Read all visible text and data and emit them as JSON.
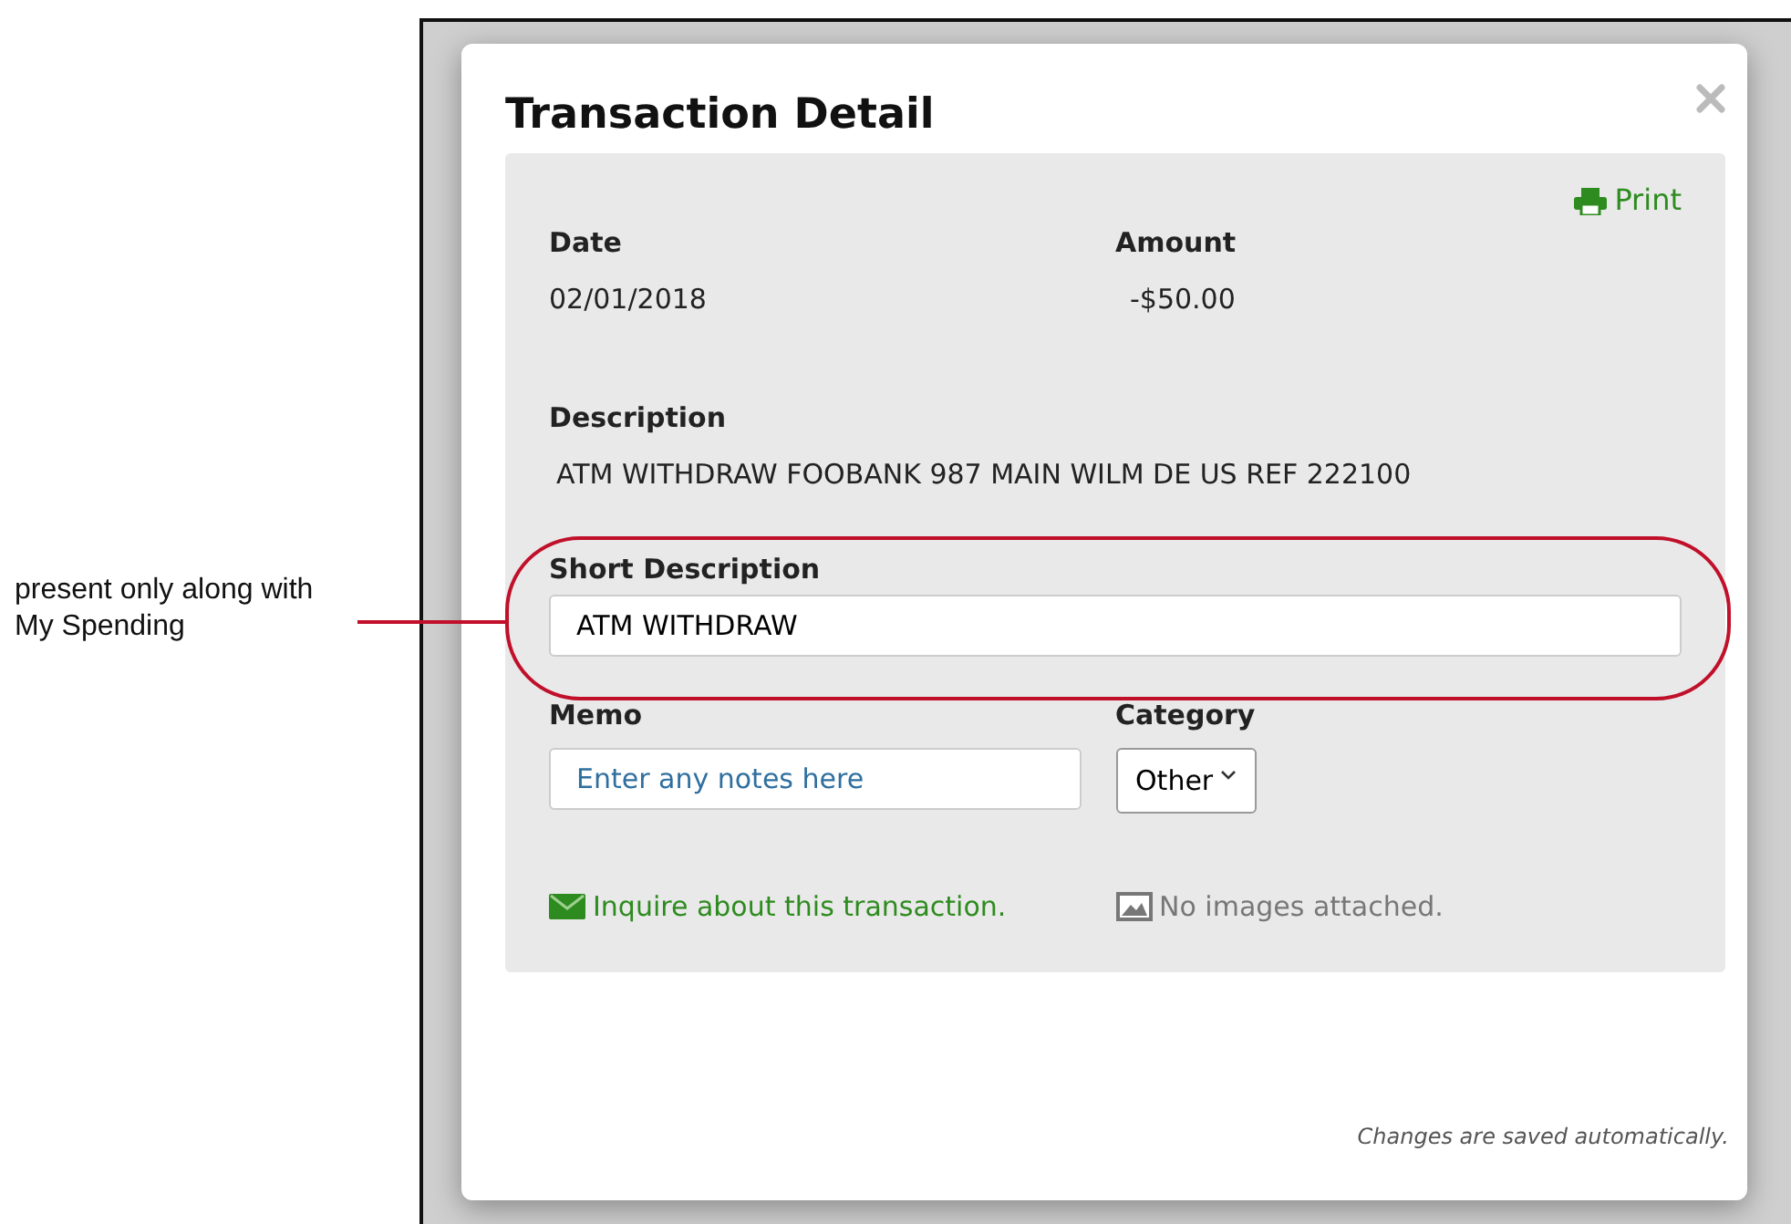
{
  "annotation": {
    "text": "present only along with My Spending"
  },
  "modal": {
    "title": "Transaction Detail",
    "print_link": "Print",
    "date": {
      "label": "Date",
      "value": "02/01/2018"
    },
    "amount": {
      "label": "Amount",
      "value": "-$50.00"
    },
    "description": {
      "label": "Description",
      "value": "ATM WITHDRAW FOOBANK 987 MAIN WILM DE US REF 222100"
    },
    "short_description": {
      "label": "Short Description",
      "value": "ATM WITHDRAW"
    },
    "memo": {
      "label": "Memo",
      "placeholder": "Enter any notes here"
    },
    "category": {
      "label": "Category",
      "value": "Other"
    },
    "inquire_link": "Inquire about this transaction.",
    "images_note": "No images attached.",
    "footer_note": "Changes are saved automatically."
  }
}
